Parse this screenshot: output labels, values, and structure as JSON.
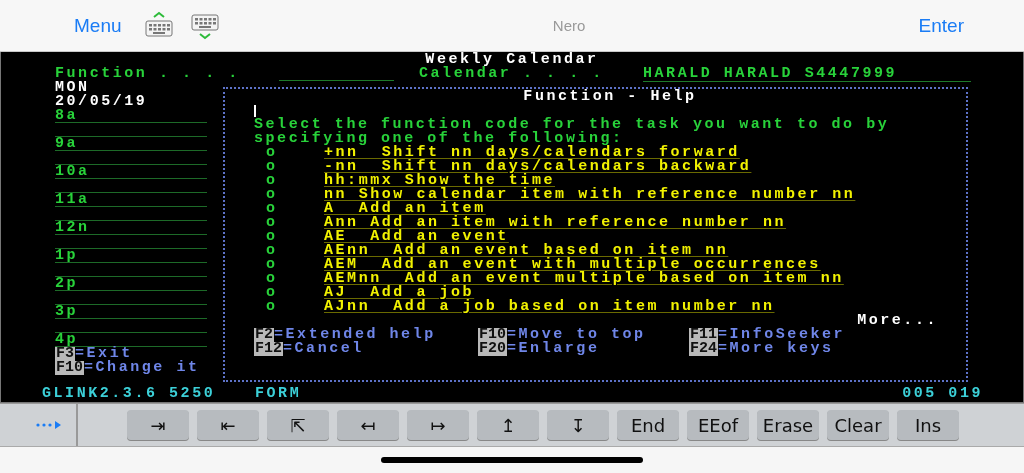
{
  "top_bar": {
    "menu": "Menu",
    "title": "Nero",
    "enter": "Enter"
  },
  "terminal": {
    "title": "Weekly Calendar",
    "function_label": "Function . . . .",
    "calendar_label": "Calendar . . . .",
    "calendar_value": "HARALD HARALD S4447999",
    "day": "MON",
    "date": "20/05/19",
    "time_slots": [
      "8a",
      "9a",
      "10a",
      "11a",
      "12n",
      "1p",
      "2p",
      "3p",
      "4p"
    ],
    "left_keys": [
      {
        "key": "F3",
        "label": "=Exit"
      },
      {
        "key": "F10",
        "label": "=Change it"
      }
    ],
    "help": {
      "title": "Function - Help",
      "intro": [
        "Select the function code for the task you want to do by",
        "specifying one of the following:"
      ],
      "items": [
        {
          "bullet": "o",
          "text": "+nn  Shift nn days/calendars forward"
        },
        {
          "bullet": "o",
          "text": "-nn  Shift nn days/calendars backward"
        },
        {
          "bullet": "o",
          "text": "hh:mmx Show the time"
        },
        {
          "bullet": "o",
          "text": "nn Show calendar item with reference number nn"
        },
        {
          "bullet": "o",
          "text": "A  Add an item"
        },
        {
          "bullet": "o",
          "text": "Ann Add an item with reference number nn"
        },
        {
          "bullet": "o",
          "text": "AE  Add an event"
        },
        {
          "bullet": "o",
          "text": "AEnn  Add an event based on item nn"
        },
        {
          "bullet": "o",
          "text": "AEM  Add an event with multiple occurrences"
        },
        {
          "bullet": "o",
          "text": "AEMnn  Add an event multiple based on item nn"
        },
        {
          "bullet": "o",
          "text": "AJ  Add a job"
        },
        {
          "bullet": "o",
          "text": "AJnn  Add a job based on item number nn"
        }
      ],
      "more": "More...",
      "key_rows": [
        [
          {
            "key": "F2",
            "label": "=Extended help"
          },
          {
            "key": "F10",
            "label": "=Move to top"
          },
          {
            "key": "F11",
            "label": "=InfoSeeker"
          }
        ],
        [
          {
            "key": "F12",
            "label": "=Cancel"
          },
          {
            "key": "F20",
            "label": "=Enlarge"
          },
          {
            "key": "F24",
            "label": "=More keys"
          }
        ]
      ]
    },
    "status": {
      "session": "GLINK2.3.6 5250",
      "mode": "FORM",
      "position": "005 019"
    }
  },
  "toolbar": {
    "keys": [
      "⇥",
      "⇤",
      "⇱",
      "↤",
      "↦",
      "↥",
      "↧",
      "End",
      "EEof",
      "Erase",
      "Clear",
      "Ins"
    ]
  }
}
